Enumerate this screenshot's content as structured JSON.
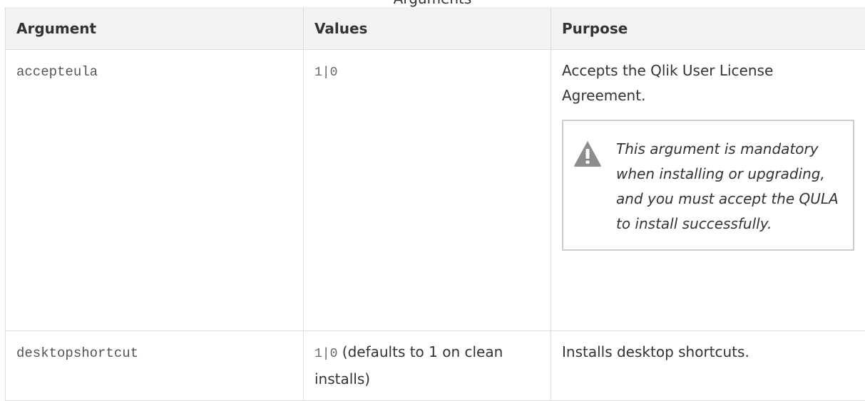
{
  "caption": "Arguments",
  "table": {
    "headers": [
      "Argument",
      "Values",
      "Purpose"
    ],
    "rows": [
      {
        "argument": "accepteula",
        "values_code": "1|0",
        "values_note": "",
        "purpose": "Accepts the Qlik User License Agreement.",
        "warning": {
          "icon": "warning-triangle-icon",
          "text": "This argument is mandatory when installing or upgrading, and you must accept the QULA to install successfully."
        }
      },
      {
        "argument": "desktopshortcut",
        "values_code": "1|0",
        "values_note": " (defaults to 1 on clean installs)",
        "purpose": "Installs desktop shortcuts."
      }
    ]
  },
  "colors": {
    "header_bg": "#f2f2f2",
    "border": "#dcdcdc",
    "warning_icon": "#8c8c8c"
  }
}
